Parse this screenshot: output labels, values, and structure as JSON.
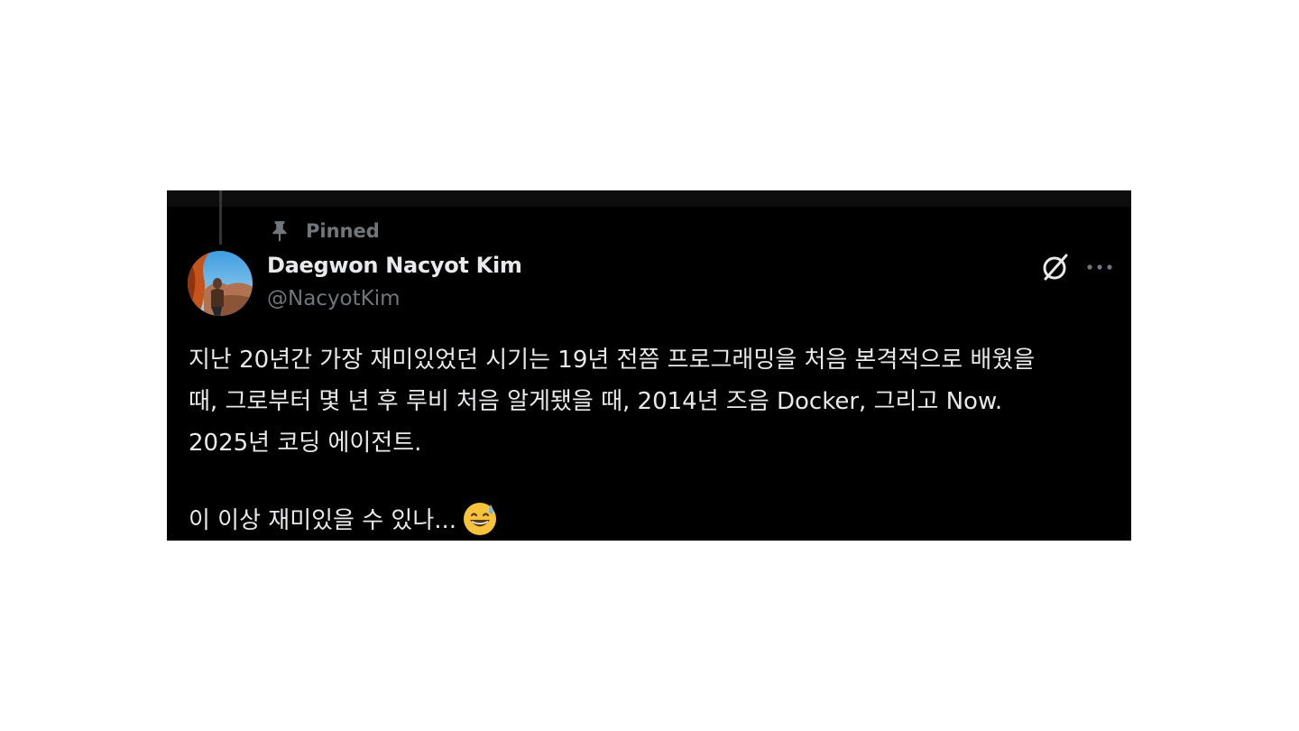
{
  "tweet": {
    "pinned_label": "Pinned",
    "author": {
      "display_name": "Daegwon Nacyot Kim",
      "handle": "@NacyotKim"
    },
    "icons": {
      "pin": "pin-icon",
      "grok": "grok-icon",
      "more": "more-icon",
      "emoji": "grinning-face-with-sweat-emoji"
    },
    "text_lines": [
      "지난 20년간 가장 재미있었던 시기는 19년 전쯤 프로그래밍을 처음 본격적으로 배웠을",
      "때, 그로부터 몇 년 후 루비 처음 알게됐을 때, 2014년 즈음 Docker, 그리고 Now.",
      "2025년 코딩 에이전트.",
      "",
      "이 이상 재미있을 수 있나..."
    ],
    "colors": {
      "background": "#000000",
      "text_primary": "#e7e9ea",
      "text_secondary": "#71767b"
    }
  }
}
